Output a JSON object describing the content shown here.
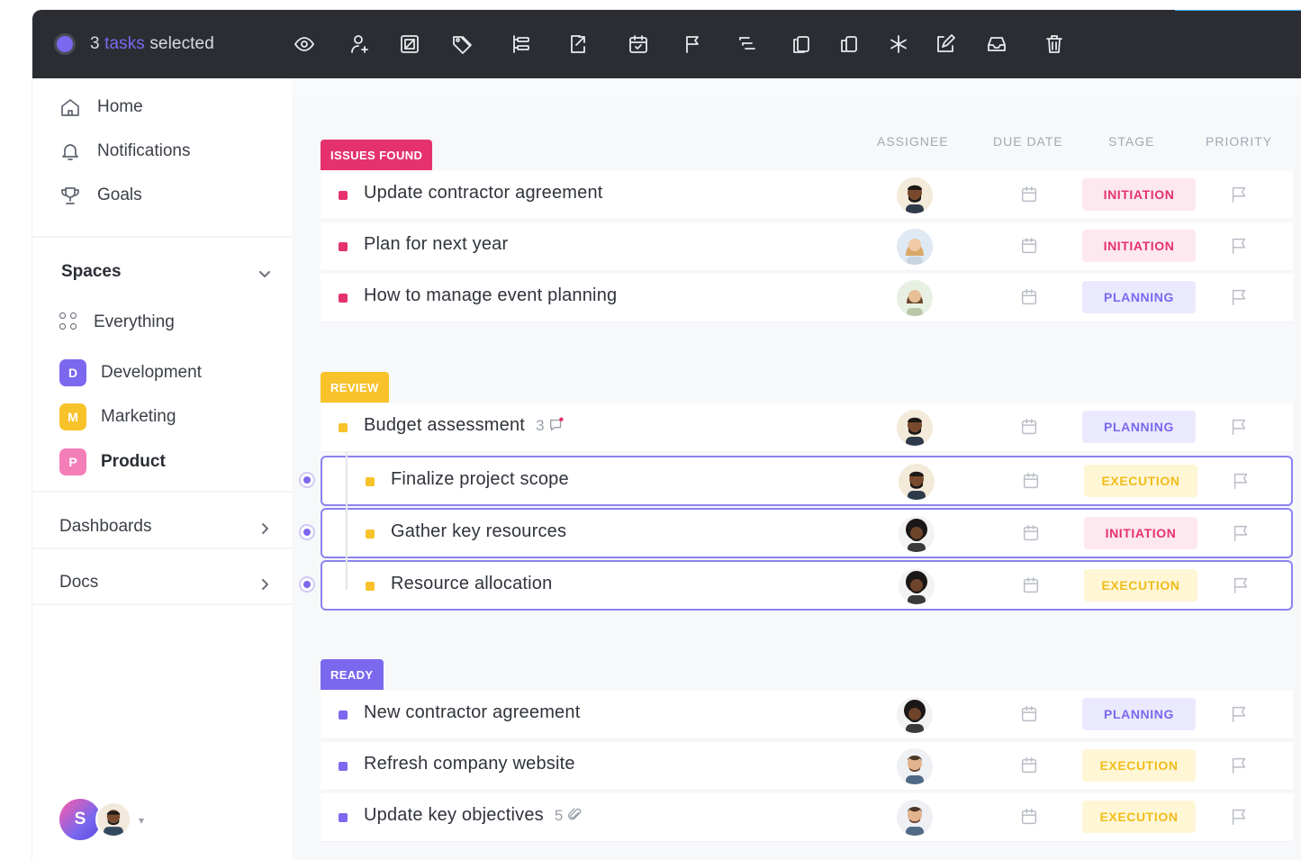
{
  "topbar": {
    "selection_count": "3",
    "selection_word": "tasks",
    "selection_suffix": "selected",
    "icons": [
      "eye-icon",
      "assign-user-icon",
      "image-icon",
      "tag-icon",
      "list-icon",
      "export-icon",
      "calendar-icon",
      "flag-icon",
      "subtask-icon",
      "copy-icon",
      "duplicate-icon",
      "asterisk-icon",
      "edit-icon",
      "inbox-icon",
      "trash-icon"
    ]
  },
  "sidebar": {
    "nav": [
      {
        "label": "Home",
        "icon": "home-icon"
      },
      {
        "label": "Notifications",
        "icon": "bell-icon"
      },
      {
        "label": "Goals",
        "icon": "trophy-icon"
      }
    ],
    "spaces_label": "Spaces",
    "everything_label": "Everything",
    "spaces": [
      {
        "letter": "D",
        "label": "Development",
        "color": "#7b68ee"
      },
      {
        "letter": "M",
        "label": "Marketing",
        "color": "#f8c22a"
      },
      {
        "letter": "P",
        "label": "Product",
        "color": "#f47eb7"
      }
    ],
    "dashboards_label": "Dashboards",
    "docs_label": "Docs",
    "user_initial": "S"
  },
  "columns": {
    "assignee": "ASSIGNEE",
    "due_date": "DUE DATE",
    "stage": "STAGE",
    "priority": "PRIORITY"
  },
  "groups": [
    {
      "label": "ISSUES FOUND",
      "color": "#e5326f",
      "tasks": [
        {
          "title": "Update contractor agreement",
          "meta": "",
          "stage": "INITIATION",
          "assignee": "man-beard-avatar"
        },
        {
          "title": "Plan for next year",
          "meta": "",
          "stage": "INITIATION",
          "assignee": "woman-blonde-avatar"
        },
        {
          "title": "How to manage event planning",
          "meta": "",
          "stage": "PLANNING",
          "assignee": "woman-avatar"
        }
      ]
    },
    {
      "label": "REVIEW",
      "color": "#f8c22a",
      "tasks": [
        {
          "title": "Budget assessment",
          "meta": "3",
          "meta_icon": "comment-icon",
          "stage": "PLANNING",
          "assignee": "man-beard-avatar"
        },
        {
          "title": "Finalize project scope",
          "meta": "",
          "stage": "EXECUTION",
          "assignee": "man-beard-avatar",
          "selected": true
        },
        {
          "title": "Gather key resources",
          "meta": "",
          "stage": "INITIATION",
          "assignee": "curly-hair-avatar",
          "selected": true
        },
        {
          "title": "Resource allocation",
          "meta": "",
          "stage": "EXECUTION",
          "assignee": "curly-hair-avatar",
          "selected": true
        }
      ]
    },
    {
      "label": "READY",
      "color": "#7b68ee",
      "tasks": [
        {
          "title": "New contractor agreement",
          "meta": "",
          "stage": "PLANNING",
          "assignee": "curly-hair-avatar"
        },
        {
          "title": "Refresh company website",
          "meta": "",
          "stage": "EXECUTION",
          "assignee": "man-avatar"
        },
        {
          "title": "Update key objectives",
          "meta": "5",
          "meta_icon": "attachment-icon",
          "stage": "EXECUTION",
          "assignee": "man-avatar"
        }
      ]
    }
  ],
  "stage_colors": {
    "INITIATION": {
      "bg": "#fde8ef",
      "fg": "#e5326f"
    },
    "PLANNING": {
      "bg": "#ebe9fd",
      "fg": "#7b68ee"
    },
    "EXECUTION": {
      "bg": "#fff6d6",
      "fg": "#f0bd1a"
    }
  }
}
